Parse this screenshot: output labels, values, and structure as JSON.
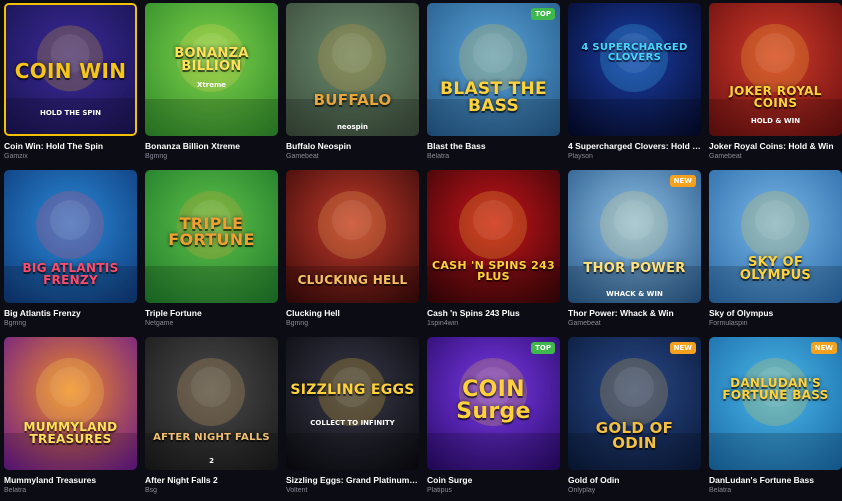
{
  "games": [
    {
      "title": "Coin Win: Hold The Spin",
      "provider": "Gamzix",
      "art": "COIN WIN",
      "art_sub": "HOLD THE SPIN",
      "badge": "",
      "bg1": "#3a2a9a",
      "bg2": "#1a1450",
      "accent": "#f5c518",
      "selected": true
    },
    {
      "title": "Bonanza Billion Xtreme",
      "provider": "Bgmng",
      "art": "BONANZA BILLION",
      "art_sub": "Xtreme",
      "badge": "",
      "bg1": "#7fd24a",
      "bg2": "#2f8a2a",
      "accent": "#ffe15a",
      "selected": false
    },
    {
      "title": "Buffalo Neospin",
      "provider": "Gamebeat",
      "art": "BUFFALO",
      "art_sub": "neospin",
      "badge": "",
      "bg1": "#6a8c6e",
      "bg2": "#3b4a3a",
      "accent": "#e8a53a",
      "selected": false
    },
    {
      "title": "Blast the Bass",
      "provider": "Belatra",
      "art": "BLAST THE BASS",
      "art_sub": "",
      "badge": "TOP",
      "bg1": "#5aa3d8",
      "bg2": "#245a8a",
      "accent": "#ffd23a",
      "selected": false
    },
    {
      "title": "4 Supercharged Clovers: Hold a...",
      "provider": "Playson",
      "art": "4 SUPERCHARGED CLOVERS",
      "art_sub": "",
      "badge": "",
      "bg1": "#1a3ea8",
      "bg2": "#050a2a",
      "accent": "#4ad3ff",
      "selected": false
    },
    {
      "title": "Joker Royal Coins: Hold & Win",
      "provider": "Gamebeat",
      "art": "JOKER ROYAL COINS",
      "art_sub": "HOLD & WIN",
      "badge": "",
      "bg1": "#d23a2a",
      "bg2": "#6a1010",
      "accent": "#ffd23a",
      "selected": false
    },
    {
      "title": "Big Atlantis Frenzy",
      "provider": "Bgmng",
      "art": "BIG ATLANTIS FRENZY",
      "art_sub": "",
      "badge": "",
      "bg1": "#2a8ad8",
      "bg2": "#0f3a7a",
      "accent": "#ff4a6a",
      "selected": false
    },
    {
      "title": "Triple Fortune",
      "provider": "Netgame",
      "art": "TRIPLE FORTUNE",
      "art_sub": "",
      "badge": "",
      "bg1": "#5fc24a",
      "bg2": "#1f7a2a",
      "accent": "#f0a030",
      "selected": false
    },
    {
      "title": "Clucking Hell",
      "provider": "Bgmng",
      "art": "CLUCKING HELL",
      "art_sub": "",
      "badge": "",
      "bg1": "#c23a2a",
      "bg2": "#3a0a0a",
      "accent": "#f5c060",
      "selected": false
    },
    {
      "title": "Cash 'n Spins 243 Plus",
      "provider": "1spin4win",
      "art": "CASH 'N SPINS 243 PLUS",
      "art_sub": "",
      "badge": "",
      "bg1": "#c8141a",
      "bg2": "#3a0508",
      "accent": "#ffd23a",
      "selected": false
    },
    {
      "title": "Thor Power: Whack & Win",
      "provider": "Gamebeat",
      "art": "THOR POWER",
      "art_sub": "WHACK & WIN",
      "badge": "NEW",
      "bg1": "#8ec2e8",
      "bg2": "#2a5a8a",
      "accent": "#ffe07a",
      "selected": false
    },
    {
      "title": "Sky of Olympus",
      "provider": "Formulaspin",
      "art": "SKY OF OLYMPUS",
      "art_sub": "",
      "badge": "",
      "bg1": "#7ab8e8",
      "bg2": "#2a6aa8",
      "accent": "#ffd23a",
      "selected": false
    },
    {
      "title": "Mummyland Treasures",
      "provider": "Belatra",
      "art": "MUMMYLAND TREASURES",
      "art_sub": "",
      "badge": "",
      "bg1": "#f08a2a",
      "bg2": "#6a1a8a",
      "accent": "#ffe15a",
      "selected": false
    },
    {
      "title": "After Night Falls 2",
      "provider": "Bsg",
      "art": "AFTER NIGHT FALLS",
      "art_sub": "2",
      "badge": "",
      "bg1": "#4a4a4a",
      "bg2": "#1a1a1a",
      "accent": "#f0c070",
      "selected": false
    },
    {
      "title": "Sizzling Eggs: Grand Platinum E...",
      "provider": "Voltent",
      "art": "SIZZLING EGGS",
      "art_sub": "COLLECT TO INFINITY",
      "badge": "",
      "bg1": "#3a3a4a",
      "bg2": "#0a0a10",
      "accent": "#ffd23a",
      "selected": false
    },
    {
      "title": "Coin Surge",
      "provider": "Platipus",
      "art": "COIN Surge",
      "art_sub": "",
      "badge": "TOP",
      "bg1": "#7a3ae8",
      "bg2": "#2a0a6a",
      "accent": "#ffd23a",
      "selected": false
    },
    {
      "title": "Gold of Odin",
      "provider": "Onlyplay",
      "art": "GOLD OF ODIN",
      "art_sub": "",
      "badge": "NEW",
      "bg1": "#2a4a8a",
      "bg2": "#0a1a3a",
      "accent": "#f5c040",
      "selected": false
    },
    {
      "title": "DanLudan's Fortune Bass",
      "provider": "Belatra",
      "art": "DANLUDAN'S FORTUNE BASS",
      "art_sub": "",
      "badge": "NEW",
      "bg1": "#4ab8e8",
      "bg2": "#1a6aa8",
      "accent": "#ffd23a",
      "selected": false
    }
  ]
}
